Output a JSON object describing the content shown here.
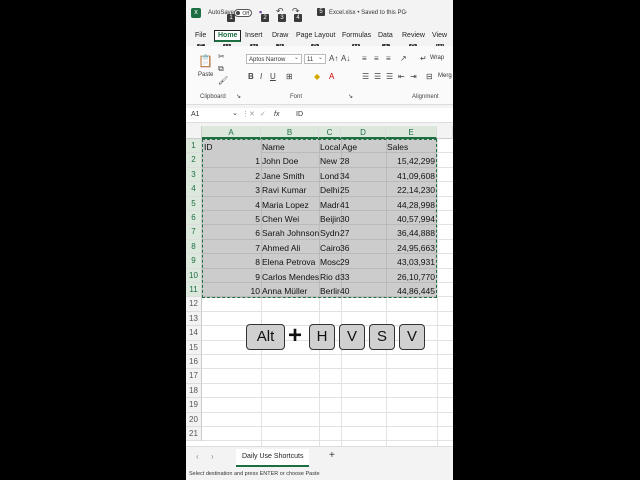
{
  "titlebar": {
    "autosave_label": "AutoSave",
    "autosave_state": "Off",
    "file_title": "Excel.xlsx • Saved to this PC",
    "keytips": [
      "1",
      "2",
      "3",
      "4",
      "5"
    ]
  },
  "tabs": [
    {
      "label": "File",
      "keytip": "F"
    },
    {
      "label": "Home",
      "keytip": "H"
    },
    {
      "label": "Insert",
      "keytip": "N"
    },
    {
      "label": "Draw",
      "keytip": "JI"
    },
    {
      "label": "Page Layout",
      "keytip": "P"
    },
    {
      "label": "Formulas",
      "keytip": "M"
    },
    {
      "label": "Data",
      "keytip": "A"
    },
    {
      "label": "Review",
      "keytip": "R"
    },
    {
      "label": "View",
      "keytip": "W"
    }
  ],
  "ribbon": {
    "paste_label": "Paste",
    "font_name": "Aptos Narrow",
    "font_size": "11",
    "wrap_label": "Wrap",
    "merge_label": "Merg",
    "groups": {
      "clipboard": "Clipboard",
      "font": "Font",
      "alignment": "Alignment"
    }
  },
  "formula_bar": {
    "name_box": "A1",
    "fx": "fx",
    "content": "ID"
  },
  "grid": {
    "columns": [
      "A",
      "B",
      "C",
      "D",
      "E"
    ],
    "rows": [
      "1",
      "2",
      "3",
      "4",
      "5",
      "6",
      "7",
      "8",
      "9",
      "10",
      "11",
      "12",
      "13",
      "14",
      "15",
      "16",
      "17",
      "18",
      "19",
      "20",
      "21"
    ],
    "header": {
      "id": "ID",
      "name": "Name",
      "location": "Local",
      "age": "Age",
      "sales": "Sales"
    },
    "data": [
      {
        "id": "1",
        "name": "John Doe",
        "location": "New Y",
        "age": "28",
        "sales": "15,42,299"
      },
      {
        "id": "2",
        "name": "Jane Smith",
        "location": "Lond",
        "age": "34",
        "sales": "41,09,608"
      },
      {
        "id": "3",
        "name": "Ravi Kumar",
        "location": "Delhi",
        "age": "25",
        "sales": "22,14,230"
      },
      {
        "id": "4",
        "name": "Maria Lopez",
        "location": "Madri",
        "age": "41",
        "sales": "44,28,998"
      },
      {
        "id": "5",
        "name": "Chen Wei",
        "location": "Beijin",
        "age": "30",
        "sales": "40,57,994"
      },
      {
        "id": "6",
        "name": "Sarah Johnson",
        "location": "Sydne",
        "age": "27",
        "sales": "36,44,888"
      },
      {
        "id": "7",
        "name": "Ahmed Ali",
        "location": "Cairo",
        "age": "36",
        "sales": "24,95,663"
      },
      {
        "id": "8",
        "name": "Elena Petrova",
        "location": "Mosc",
        "age": "29",
        "sales": "43,03,931"
      },
      {
        "id": "9",
        "name": "Carlos Mendes",
        "location": "Rio d",
        "age": "33",
        "sales": "26,10,770"
      },
      {
        "id": "10",
        "name": "Anna Müller",
        "location": "Berlir",
        "age": "40",
        "sales": "44,86,445"
      }
    ]
  },
  "sheets": {
    "active": "Daily Use Shortcuts",
    "add": "+"
  },
  "status_text": "Select destination and press ENTER or choose Paste",
  "shortcut_keys": {
    "k1": "Alt",
    "plus": "+",
    "k2": "H",
    "k3": "V",
    "k4": "S",
    "k5": "V"
  },
  "colors": {
    "accent": "#1d6f42",
    "keytip_bg": "#3a3a3a",
    "selection": "#787878"
  }
}
